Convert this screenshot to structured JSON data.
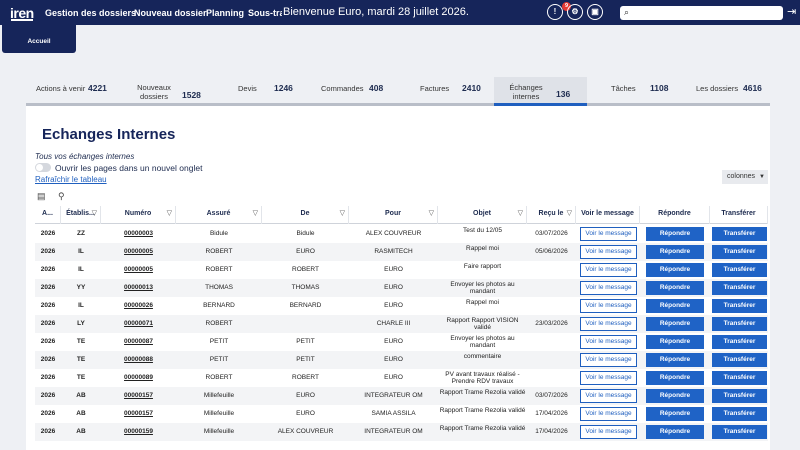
{
  "header": {
    "logo": "iren",
    "nav": [
      "Gestion des dossiers",
      "Nouveau dossier",
      "Planning",
      "Sous-traitance"
    ],
    "welcome": "Bienvenue Euro, mardi 28 juillet 2026.",
    "notification_count": "9",
    "search_placeholder": ""
  },
  "accueil": "Accueil",
  "tabs": [
    {
      "label": "Actions à venir",
      "count": "4221"
    },
    {
      "label": "Nouveaux dossiers",
      "count": "1528"
    },
    {
      "label": "Devis",
      "count": "1246"
    },
    {
      "label": "Commandes",
      "count": "408"
    },
    {
      "label": "Factures",
      "count": "2410"
    },
    {
      "label": "Échanges internes",
      "count": "136"
    },
    {
      "label": "Tâches",
      "count": "1108"
    },
    {
      "label": "Les dossiers",
      "count": "4616"
    }
  ],
  "page": {
    "title": "Echanges Internes",
    "subtitle": "Tous vos échanges internes",
    "toggle_label": "Ouvrir les pages dans un nouvel onglet",
    "refresh": "Rafraîchir le tableau",
    "columns_button": "colonnes"
  },
  "columns": [
    "A...",
    "Établis...",
    "Numéro",
    "Assuré",
    "De",
    "Pour",
    "Objet",
    "Reçu le",
    "Voir le message",
    "Répondre",
    "Transférer"
  ],
  "buttons": {
    "view": "Voir le message",
    "reply": "Répondre",
    "forward": "Transférer"
  },
  "rows": [
    {
      "annee": "2026",
      "etab": "ZZ",
      "numero": "00000003",
      "assure": "Bidule",
      "de": "Bidule",
      "pour": "ALEX COUVREUR",
      "objet": "Test du 12/05",
      "recu": "03/07/2026"
    },
    {
      "annee": "2026",
      "etab": "IL",
      "numero": "00000005",
      "assure": "ROBERT",
      "de": "EURO",
      "pour": "RASMITECH",
      "objet": "Rappel moi",
      "recu": "05/06/2026"
    },
    {
      "annee": "2026",
      "etab": "IL",
      "numero": "00000005",
      "assure": "ROBERT",
      "de": "ROBERT",
      "pour": "EURO",
      "objet": "Faire rapport",
      "recu": ""
    },
    {
      "annee": "2026",
      "etab": "YY",
      "numero": "00000013",
      "assure": "THOMAS",
      "de": "THOMAS",
      "pour": "EURO",
      "objet": "Envoyer les photos au mandant",
      "recu": ""
    },
    {
      "annee": "2026",
      "etab": "IL",
      "numero": "00000026",
      "assure": "BERNARD",
      "de": "BERNARD",
      "pour": "EURO",
      "objet": "Rappel moi",
      "recu": ""
    },
    {
      "annee": "2026",
      "etab": "LY",
      "numero": "00000071",
      "assure": "ROBERT",
      "de": "",
      "pour": "CHARLE III",
      "objet": "Rapport Rapport VISION validé",
      "recu": "23/03/2026"
    },
    {
      "annee": "2026",
      "etab": "TE",
      "numero": "00000087",
      "assure": "PETIT",
      "de": "PETIT",
      "pour": "EURO",
      "objet": "Envoyer les photos au mandant",
      "recu": ""
    },
    {
      "annee": "2026",
      "etab": "TE",
      "numero": "00000088",
      "assure": "PETIT",
      "de": "PETIT",
      "pour": "EURO",
      "objet": "commentaire",
      "recu": ""
    },
    {
      "annee": "2026",
      "etab": "TE",
      "numero": "00000089",
      "assure": "ROBERT",
      "de": "ROBERT",
      "pour": "EURO",
      "objet": "PV avant travaux réalisé - Prendre RDV travaux",
      "recu": ""
    },
    {
      "annee": "2026",
      "etab": "AB",
      "numero": "00000157",
      "assure": "Millefeuille",
      "de": "EURO",
      "pour": "INTEGRATEUR OM",
      "objet": "Rapport Trame Rezolia validé",
      "recu": "03/07/2026"
    },
    {
      "annee": "2026",
      "etab": "AB",
      "numero": "00000157",
      "assure": "Millefeuille",
      "de": "EURO",
      "pour": "SAMIA ASSILA",
      "objet": "Rapport Trame Rezolia validé",
      "recu": "17/04/2026"
    },
    {
      "annee": "2026",
      "etab": "AB",
      "numero": "00000159",
      "assure": "Millefeuille",
      "de": "ALEX COUVREUR",
      "pour": "INTEGRATEUR OM",
      "objet": "Rapport Trame Rezolia validé",
      "recu": "17/04/2026"
    }
  ]
}
